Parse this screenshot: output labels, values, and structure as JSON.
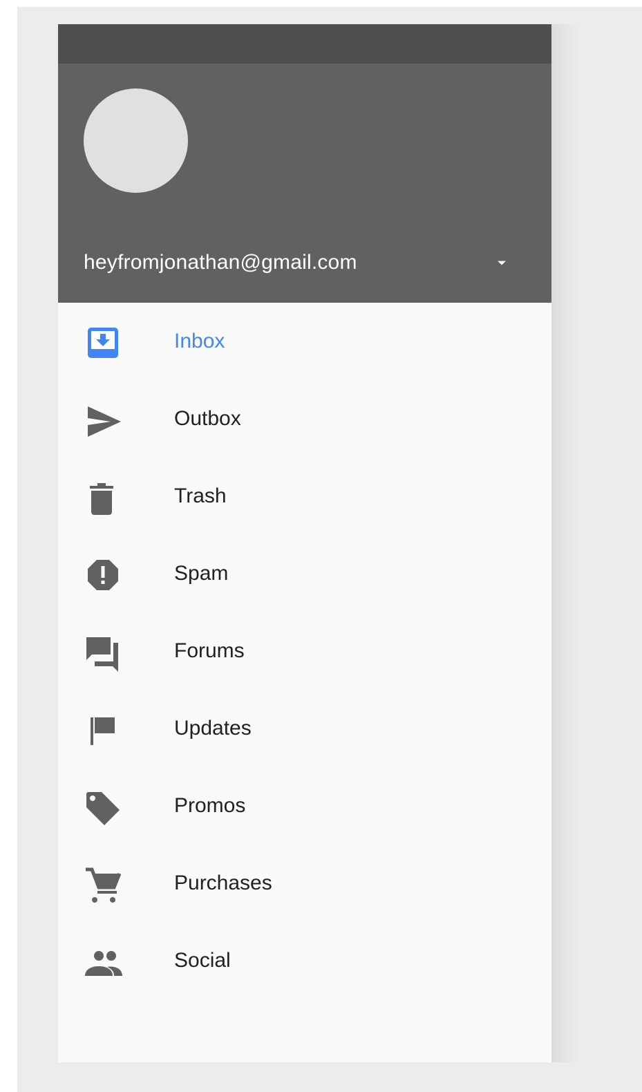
{
  "account": {
    "email": "heyfromjonathan@gmail.com",
    "avatar_icon": "avatar-placeholder",
    "dropdown_icon": "arrow-drop-down-icon"
  },
  "colors": {
    "accent": "#4285f4",
    "header_background": "#616161",
    "status_bar_background": "#4f4f4f",
    "icon_color": "#616161",
    "drawer_background": "#fafafa",
    "label_color": "#212121"
  },
  "nav": {
    "items": [
      {
        "label": "Inbox",
        "icon": "inbox-icon",
        "active": true
      },
      {
        "label": "Outbox",
        "icon": "send-icon",
        "active": false
      },
      {
        "label": "Trash",
        "icon": "delete-icon",
        "active": false
      },
      {
        "label": "Spam",
        "icon": "report-icon",
        "active": false
      },
      {
        "label": "Forums",
        "icon": "forum-icon",
        "active": false
      },
      {
        "label": "Updates",
        "icon": "flag-icon",
        "active": false
      },
      {
        "label": "Promos",
        "icon": "label-icon",
        "active": false
      },
      {
        "label": "Purchases",
        "icon": "shopping-cart-icon",
        "active": false
      },
      {
        "label": "Social",
        "icon": "people-icon",
        "active": false
      }
    ]
  }
}
